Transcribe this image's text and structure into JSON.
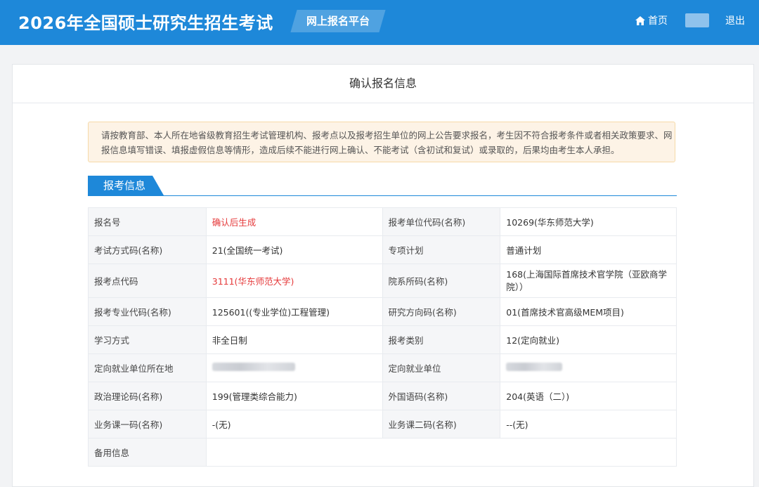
{
  "header": {
    "title": "2026年全国硕士研究生招生考试",
    "badge": "网上报名平台",
    "home_icon": "home-icon",
    "home_label": "首页",
    "logout_label": "退出"
  },
  "card": {
    "title": "确认报名信息",
    "notice": "请按教育部、本人所在地省级教育招生考试管理机构、报考点以及报考招生单位的网上公告要求报名，考生因不符合报考条件或者相关政策要求、网报信息填写错误、填报虚假信息等情形，造成后续不能进行网上确认、不能考试（含初试和复试）或录取的，后果均由考生本人承担。",
    "section_title": "报考信息"
  },
  "rows": [
    {
      "l1": "报名号",
      "v1": "确认后生成",
      "l2": "报考单位代码(名称)",
      "v2": "10269(华东师范大学)"
    },
    {
      "l1": "考试方式码(名称)",
      "v1": "21(全国统一考试)",
      "l2": "专项计划",
      "v2": "普通计划"
    },
    {
      "l1": "报考点代码",
      "v1": "3111(华东师范大学)",
      "l2": "院系所码(名称)",
      "v2": "168(上海国际首席技术官学院（亚欧商学院））"
    },
    {
      "l1": "报考专业代码(名称)",
      "v1": "125601((专业学位)工程管理)",
      "l2": "研究方向码(名称)",
      "v2": "01(首席技术官高级MEM项目)"
    },
    {
      "l1": "学习方式",
      "v1": "非全日制",
      "l2": "报考类别",
      "v2": "12(定向就业)"
    },
    {
      "l1": "定向就业单位所在地",
      "v1": "",
      "l2": "定向就业单位",
      "v2": ""
    },
    {
      "l1": "政治理论码(名称)",
      "v1": "199(管理类综合能力)",
      "l2": "外国语码(名称)",
      "v2": "204(英语（二）)"
    },
    {
      "l1": "业务课一码(名称)",
      "v1": "-(无)",
      "l2": "业务课二码(名称)",
      "v2": "--(无)"
    },
    {
      "l1": "备用信息",
      "v1": "",
      "l2": "",
      "v2": ""
    }
  ],
  "colors": {
    "brand": "#1e88d9",
    "highlight": "#e5393a",
    "notice_bg": "#fdf3e6"
  }
}
